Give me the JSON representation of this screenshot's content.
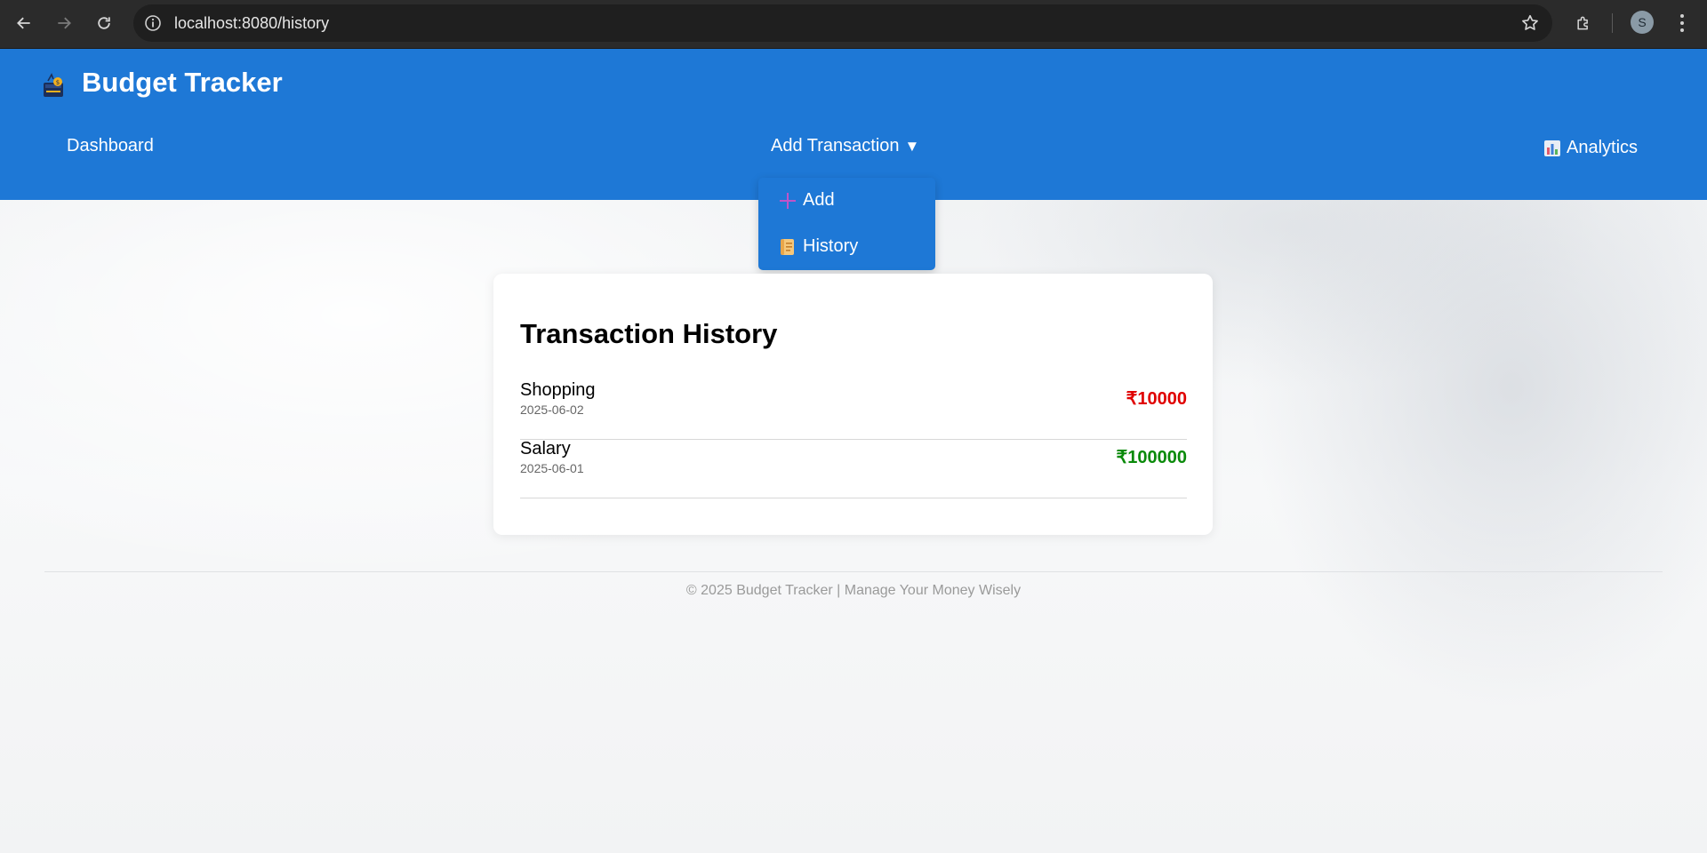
{
  "browser": {
    "url": "localhost:8080/history",
    "profile_initial": "S"
  },
  "navbar": {
    "brand": "Budget Tracker",
    "links": {
      "dashboard": "Dashboard",
      "add_transaction": "Add Transaction",
      "add_transaction_caret": "▼",
      "analytics": "Analytics"
    },
    "dropdown": [
      {
        "label": "Add",
        "icon": "plus-icon"
      },
      {
        "label": "History",
        "icon": "scroll-icon"
      }
    ],
    "colors": {
      "navbar_bg": "#1e78d6",
      "text": "#ffffff"
    }
  },
  "card": {
    "title": "Transaction History",
    "transactions": [
      {
        "name": "Shopping",
        "date": "2025-06-02",
        "amount": "₹10000",
        "type": "expense",
        "color": "#e00000"
      },
      {
        "name": "Salary",
        "date": "2025-06-01",
        "amount": "₹100000",
        "type": "income",
        "color": "#0a8a0a"
      }
    ]
  },
  "footer": {
    "text": "© 2025 Budget Tracker | Manage Your Money Wisely"
  }
}
